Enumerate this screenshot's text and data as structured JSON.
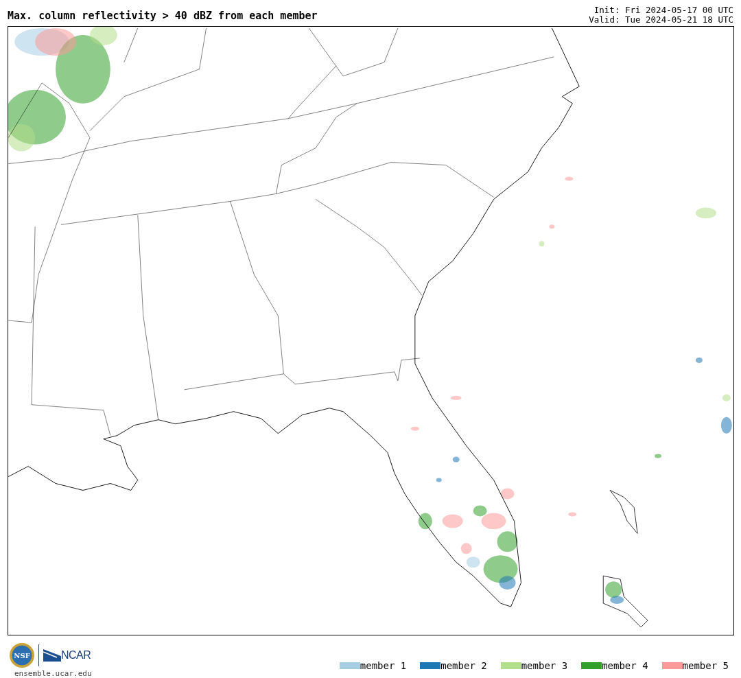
{
  "title": "Max. column reflectivity > 40 dBZ from each member",
  "init": "Init: Fri 2024-05-17 00 UTC",
  "valid": "Valid: Tue 2024-05-21 18 UTC",
  "logos": {
    "nsf": "NSF",
    "ncar": "NCAR"
  },
  "site": "ensemble.ucar.edu",
  "legend": [
    {
      "label": "member 1",
      "color": "#a6cee3"
    },
    {
      "label": "member 2",
      "color": "#1f78b4"
    },
    {
      "label": "member 3",
      "color": "#b2df8a"
    },
    {
      "label": "member 4",
      "color": "#33a02c"
    },
    {
      "label": "member 5",
      "color": "#fb9a99"
    }
  ]
}
